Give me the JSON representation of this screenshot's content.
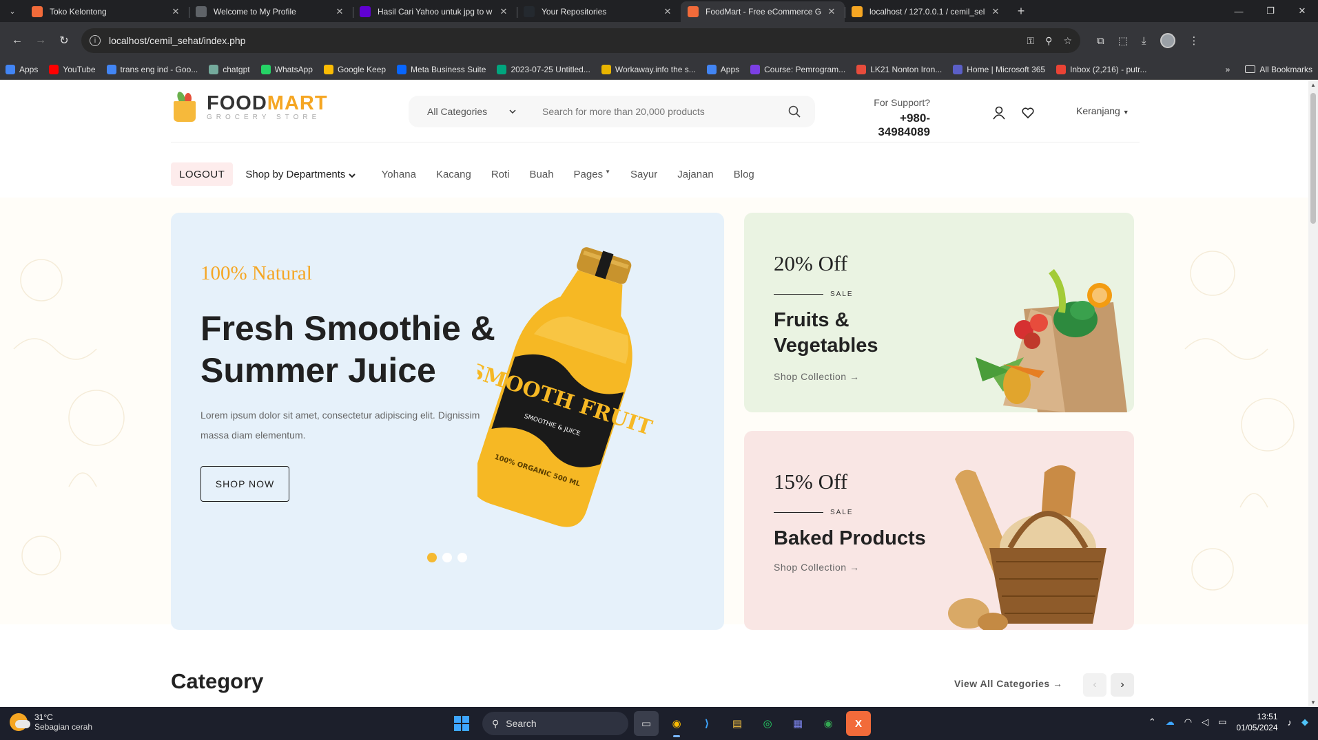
{
  "browser": {
    "tabs": [
      {
        "title": "Toko Kelontong",
        "icon": "foodmart-favicon",
        "color": "#f26b3a",
        "active": false
      },
      {
        "title": "Welcome to My Profile",
        "icon": "globe-icon",
        "color": "#5f6368",
        "active": false
      },
      {
        "title": "Hasil Cari Yahoo untuk jpg to w",
        "icon": "yahoo-icon",
        "color": "#6001d2",
        "active": false
      },
      {
        "title": "Your Repositories",
        "icon": "github-icon",
        "color": "#24292f",
        "active": false
      },
      {
        "title": "FoodMart - Free eCommerce G",
        "icon": "foodmart-favicon",
        "color": "#f26b3a",
        "active": true
      },
      {
        "title": "localhost / 127.0.0.1 / cemil_sel",
        "icon": "phpmyadmin-icon",
        "color": "#f5a623",
        "active": false
      }
    ],
    "url": "localhost/cemil_sehat/index.php",
    "bookmarks": [
      {
        "label": "Apps",
        "color": "#4285f4"
      },
      {
        "label": "YouTube",
        "color": "#ff0000"
      },
      {
        "label": "trans eng ind - Goo...",
        "color": "#4285f4"
      },
      {
        "label": "chatgpt",
        "color": "#74aa9c"
      },
      {
        "label": "WhatsApp",
        "color": "#25d366"
      },
      {
        "label": "Google Keep",
        "color": "#fbbc04"
      },
      {
        "label": "Meta Business Suite",
        "color": "#0866ff"
      },
      {
        "label": "2023-07-25 Untitled...",
        "color": "#00a67e"
      },
      {
        "label": "Workaway.info the s...",
        "color": "#e8b500"
      },
      {
        "label": "Apps",
        "color": "#4285f4"
      },
      {
        "label": "Course: Pemrogram...",
        "color": "#7b3fe4"
      },
      {
        "label": "LK21 Nonton Iron...",
        "color": "#e74c3c"
      },
      {
        "label": "Home | Microsoft 365",
        "color": "#5b5fc7"
      },
      {
        "label": "Inbox (2,216) - putr...",
        "color": "#ea4335"
      }
    ],
    "bookmarks_more": "»",
    "all_bookmarks": "All Bookmarks"
  },
  "header": {
    "logo_word1": "FOOD",
    "logo_word2": "MART",
    "logo_tagline": "GROCERY STORE",
    "category_select": "All Categories",
    "search_placeholder": "Search for more than 20,000 products",
    "support_label": "For Support?",
    "support_phone": "+980-34984089",
    "cart_label": "Keranjang"
  },
  "nav": {
    "logout": "LOGOUT",
    "departments": "Shop by Departments",
    "links": [
      "Yohana",
      "Kacang",
      "Roti",
      "Buah",
      "Pages",
      "Sayur",
      "Jajanan",
      "Blog"
    ]
  },
  "hero": {
    "kicker": "100% Natural",
    "headline": "Fresh Smoothie & Summer Juice",
    "description": "Lorem ipsum dolor sit amet, consectetur adipiscing elit. Dignissim massa diam elementum.",
    "cta": "SHOP NOW",
    "bottle_text": "SMOOTH FRUIT",
    "bottle_sub": "SMOOTHIE & JUICE",
    "bottle_label": "100% ORGANIC 500 ML",
    "slide_count": 3,
    "active_slide": 0
  },
  "promos": [
    {
      "discount": "20% Off",
      "sale": "SALE",
      "title": "Fruits & Vegetables",
      "link": "Shop Collection →",
      "bg": "#eaf3e2"
    },
    {
      "discount": "15% Off",
      "sale": "SALE",
      "title": "Baked Products",
      "link": "Shop Collection →",
      "bg": "#f9e6e4"
    }
  ],
  "category": {
    "title": "Category",
    "view_all": "View All Categories →"
  },
  "taskbar": {
    "temperature": "31°C",
    "weather": "Sebagian cerah",
    "search": "Search",
    "time": "13:51",
    "date": "01/05/2024"
  },
  "colors": {
    "accent": "#f5a623",
    "hero_bg": "#e6f1fa",
    "logout_bg": "#fdecec"
  }
}
